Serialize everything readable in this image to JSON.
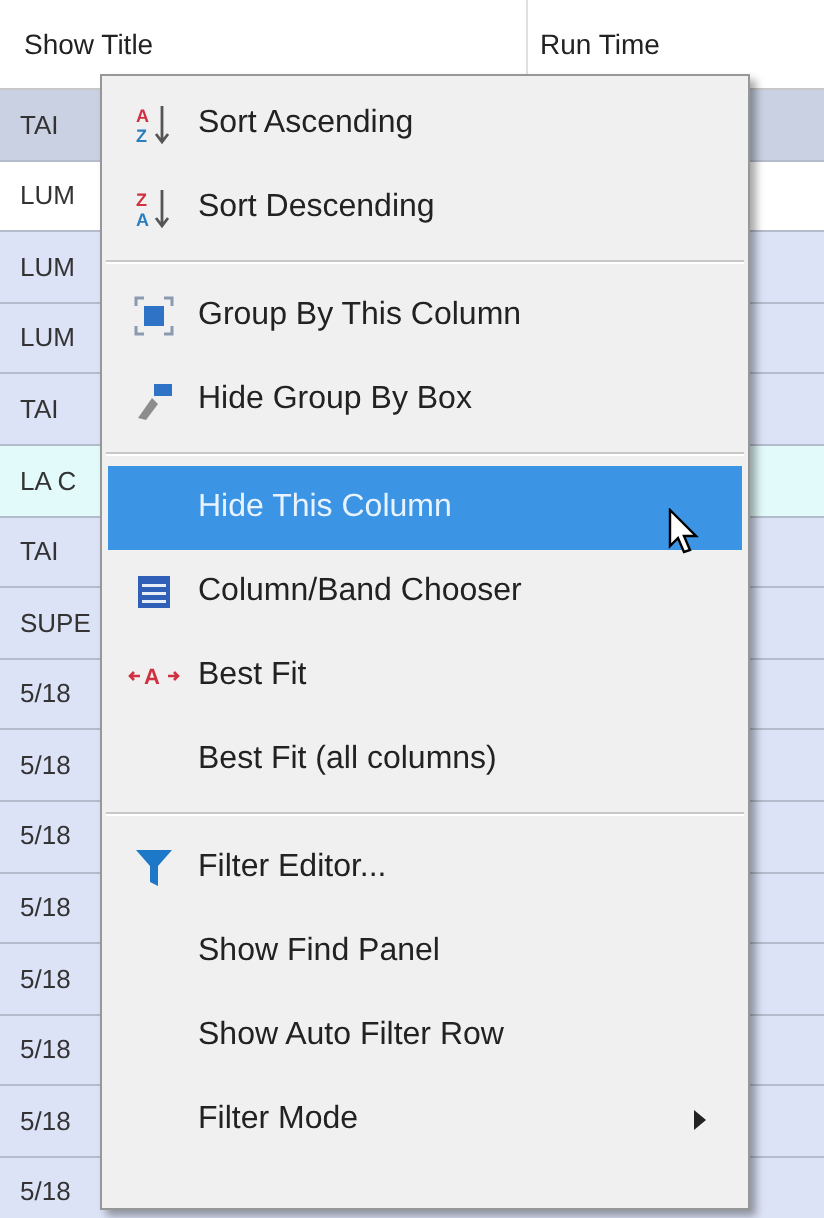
{
  "grid": {
    "columns": [
      "Show Title",
      "Run Time"
    ],
    "rows": [
      {
        "cell": "TAI",
        "kind": "focused"
      },
      {
        "cell": "LUM",
        "kind": "plain"
      },
      {
        "cell": "LUM",
        "kind": "selected"
      },
      {
        "cell": "LUM",
        "kind": "selected"
      },
      {
        "cell": "TAI",
        "kind": "selected"
      },
      {
        "cell": "LA C",
        "kind": "hover"
      },
      {
        "cell": "TAI",
        "kind": "selected"
      },
      {
        "cell": "SUPE",
        "kind": "selected"
      },
      {
        "cell": "5/18",
        "kind": "selected"
      },
      {
        "cell": "5/18",
        "kind": "selected"
      },
      {
        "cell": "5/18",
        "kind": "selected"
      },
      {
        "cell": "5/18",
        "kind": "selected"
      },
      {
        "cell": "5/18",
        "kind": "selected"
      },
      {
        "cell": "5/18",
        "kind": "selected"
      },
      {
        "cell": "5/18",
        "kind": "selected"
      },
      {
        "cell": "5/18",
        "kind": "selected"
      }
    ]
  },
  "context_menu": {
    "groups": [
      [
        {
          "label": "Sort Ascending",
          "selected": false,
          "submenu": false,
          "icon_letters": [
            "A",
            "Z"
          ]
        },
        {
          "label": "Sort Descending",
          "selected": false,
          "submenu": false,
          "icon_letters": [
            "Z",
            "A"
          ]
        }
      ],
      [
        {
          "label": "Group By This Column",
          "selected": false,
          "submenu": false
        },
        {
          "label": "Hide Group By Box",
          "selected": false,
          "submenu": false
        }
      ],
      [
        {
          "label": "Hide This Column",
          "selected": true,
          "submenu": false
        },
        {
          "label": "Column/Band Chooser",
          "selected": false,
          "submenu": false
        },
        {
          "label": "Best Fit",
          "selected": false,
          "submenu": false,
          "icon_letters": [
            "A"
          ]
        },
        {
          "label": "Best Fit (all columns)",
          "selected": false,
          "submenu": false
        }
      ],
      [
        {
          "label": "Filter Editor...",
          "selected": false,
          "submenu": false
        },
        {
          "label": "Show Find Panel",
          "selected": false,
          "submenu": false
        },
        {
          "label": "Show Auto Filter Row",
          "selected": false,
          "submenu": false
        },
        {
          "label": "Filter Mode",
          "selected": false,
          "submenu": true
        }
      ]
    ]
  }
}
